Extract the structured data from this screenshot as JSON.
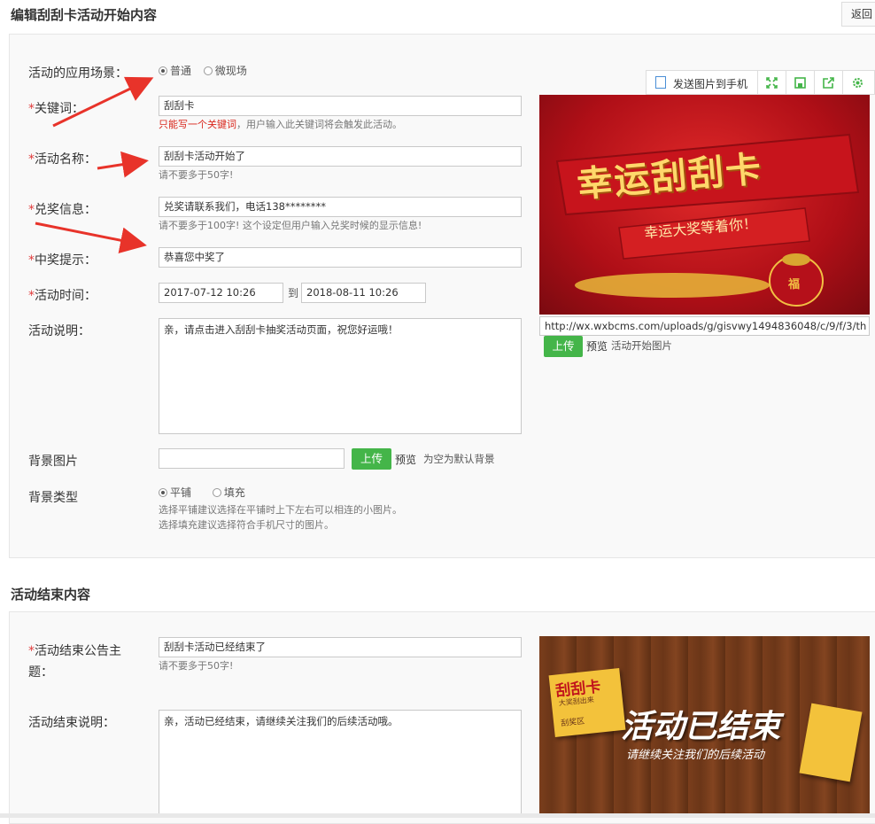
{
  "header": {
    "title": "编辑刮刮卡活动开始内容",
    "back_label": "返回"
  },
  "start": {
    "scene": {
      "label": "活动的应用场景：",
      "options": [
        "普通",
        "微现场"
      ],
      "selected": "普通"
    },
    "keyword": {
      "label": "*关键词：",
      "value": "刮刮卡",
      "hint_red": "只能写一个关键词",
      "hint_rest": "，用户输入此关键词将会触发此活动。"
    },
    "name": {
      "label": "*活动名称：",
      "value": "刮刮卡活动开始了",
      "hint": "请不要多于50字!"
    },
    "prize_info": {
      "label": "*兑奖信息：",
      "value": "兑奖请联系我们，电话138********",
      "hint": "请不要多于100字! 这个设定但用户输入兑奖时候的显示信息!"
    },
    "win_tip": {
      "label": "*中奖提示：",
      "value": "恭喜您中奖了"
    },
    "time": {
      "label": "*活动时间：",
      "start": "2017-07-12 10:26",
      "sep": "到",
      "end": "2018-08-11 10:26"
    },
    "desc": {
      "label": "活动说明：",
      "value": "亲，请点击进入刮刮卡抽奖活动页面，祝您好运哦！"
    },
    "bg_image": {
      "label": "背景图片",
      "value": "",
      "upload": "上传",
      "preview": "预览",
      "note": "为空为默认背景"
    },
    "bg_type": {
      "label": "背景类型",
      "options": [
        "平铺",
        "填充"
      ],
      "selected": "平铺",
      "hint1": "选择平铺建议选择在平铺时上下左右可以相连的小图片。",
      "hint2": "选择填充建议选择符合手机尺寸的图片。"
    },
    "image": {
      "url": "http://wx.wxbcms.com/uploads/g/gisvwy1494836048/c/9/f/3/th",
      "upload": "上传",
      "preview": "预览",
      "caption": "活动开始图片",
      "banner_title": "幸运刮刮卡",
      "banner_sub": "幸运大奖等着你！",
      "bag_glyph": "福"
    },
    "toolbar": {
      "send_label": "发送图片到手机"
    }
  },
  "end": {
    "title": "活动结束内容",
    "notice": {
      "label_line1": "*活动结束公告主",
      "label_line2": "题：",
      "value": "刮刮卡活动已经结束了",
      "hint": "请不要多于50字!"
    },
    "desc": {
      "label": "活动结束说明：",
      "value": "亲，活动已经结束，请继续关注我们的后续活动哦。"
    },
    "image": {
      "card_title": "刮刮卡",
      "card_sub": "大奖刮出来",
      "card_area": "刮奖区",
      "main": "活动已结束",
      "sub": "请继续关注我们的后续活动"
    }
  },
  "colors": {
    "accent_green": "#44b549",
    "required_red": "#e03b3b",
    "banner_red": "#c0141c",
    "wood_brown": "#6b3618"
  }
}
